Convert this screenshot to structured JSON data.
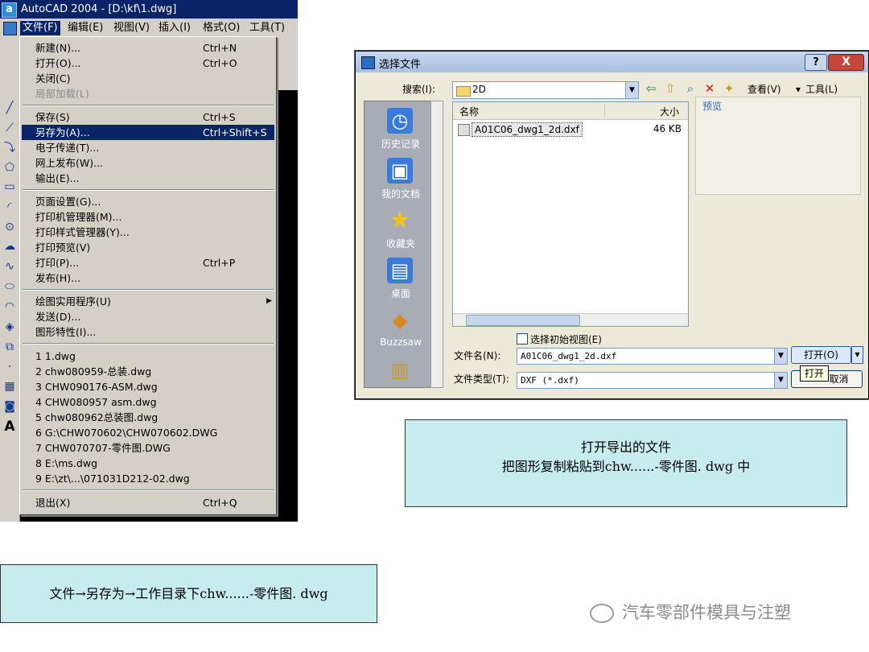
{
  "autocad": {
    "title": "AutoCAD 2004 - [D:\\kf\\1.dwg]",
    "menubar": [
      "文件(F)",
      "编辑(E)",
      "视图(V)",
      "插入(I)",
      "格式(O)",
      "工具(T)"
    ],
    "file_menu": {
      "group1": [
        {
          "label": "新建(N)...",
          "shortcut": "Ctrl+N"
        },
        {
          "label": "打开(O)...",
          "shortcut": "Ctrl+O"
        },
        {
          "label": "关闭(C)",
          "shortcut": ""
        },
        {
          "label": "局部加载(L)",
          "shortcut": ""
        }
      ],
      "group2": [
        {
          "label": "保存(S)",
          "shortcut": "Ctrl+S"
        },
        {
          "label": "另存为(A)...",
          "shortcut": "Ctrl+Shift+S"
        },
        {
          "label": "电子传递(T)...",
          "shortcut": ""
        },
        {
          "label": "网上发布(W)...",
          "shortcut": ""
        },
        {
          "label": "输出(E)...",
          "shortcut": ""
        }
      ],
      "group3": [
        {
          "label": "页面设置(G)...",
          "shortcut": ""
        },
        {
          "label": "打印机管理器(M)...",
          "shortcut": ""
        },
        {
          "label": "打印样式管理器(Y)...",
          "shortcut": ""
        },
        {
          "label": "打印预览(V)",
          "shortcut": ""
        },
        {
          "label": "打印(P)...",
          "shortcut": "Ctrl+P"
        },
        {
          "label": "发布(H)...",
          "shortcut": ""
        }
      ],
      "group4": [
        {
          "label": "绘图实用程序(U)",
          "shortcut": ""
        },
        {
          "label": "发送(D)...",
          "shortcut": ""
        },
        {
          "label": "图形特性(I)...",
          "shortcut": ""
        }
      ],
      "recent": [
        "1 1.dwg",
        "2 chw080959-总装.dwg",
        "3 CHW090176-ASM.dwg",
        "4 CHW080957 asm.dwg",
        "5 chw080962总装图.dwg",
        "6 G:\\CHW070602\\CHW070602.DWG",
        "7 CHW070707-零件图.DWG",
        "8 E:\\ms.dwg",
        "9 E:\\zt\\...\\071031D212-02.dwg"
      ],
      "exit": {
        "label": "退出(X)",
        "shortcut": "Ctrl+Q"
      }
    }
  },
  "dialog": {
    "title": "选择文件",
    "help": "?",
    "close": "X",
    "look_in_label": "搜索(I):",
    "look_in_value": "2D",
    "views_label": "查看(V)",
    "tools_label": "工具(L)",
    "places": [
      "历史记录",
      "我的文档",
      "收藏夹",
      "桌面",
      "Buzzsaw"
    ],
    "list_header_name": "名称",
    "list_header_size": "大小",
    "file": {
      "name": "A01C06_dwg1_2d.dxf",
      "size": "46 KB"
    },
    "preview_label": "预览",
    "initial_view_label": "选择初始视图(E)",
    "filename_label": "文件名(N):",
    "filename_value": "A01C06_dwg1_2d.dxf",
    "filetype_label": "文件类型(T):",
    "filetype_value": "DXF (*.dxf)",
    "open_button": "打开(O)",
    "cancel_button": "取消",
    "tooltip": "打开"
  },
  "captions": {
    "right_line1": "打开导出的文件",
    "right_line2": "把图形复制粘贴到chw......-零件图. dwg 中",
    "left": "文件→另存为→工作目录下chw......-零件图. dwg"
  },
  "watermark": "汽车零部件模具与注塑"
}
